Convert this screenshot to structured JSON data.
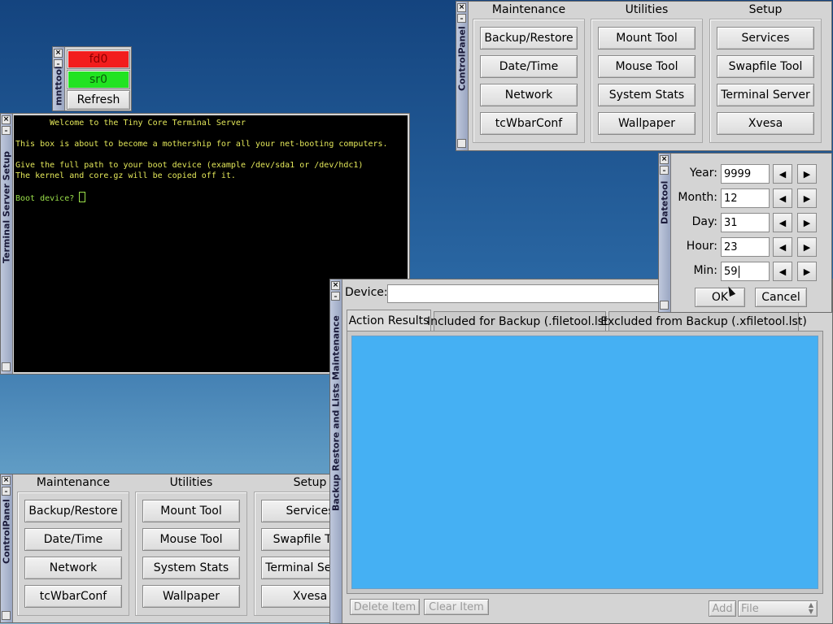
{
  "mnttool": {
    "title": "mnttool",
    "devices": [
      {
        "label": "fd0",
        "color": "#f21d1d"
      },
      {
        "label": "sr0",
        "color": "#22e322"
      }
    ],
    "refresh_label": "Refresh"
  },
  "control_panel": {
    "title": "ControlPanel",
    "groups": [
      {
        "heading": "Maintenance",
        "buttons": [
          "Backup/Restore",
          "Date/Time",
          "Network",
          "tcWbarConf"
        ]
      },
      {
        "heading": "Utilities",
        "buttons": [
          "Mount Tool",
          "Mouse Tool",
          "System Stats",
          "Wallpaper"
        ]
      },
      {
        "heading": "Setup",
        "buttons": [
          "Services",
          "Swapfile Tool",
          "Terminal Server",
          "Xvesa"
        ]
      }
    ]
  },
  "terminal_window": {
    "title": "Terminal Server Setup",
    "lines": [
      "       Welcome to the Tiny Core Terminal Server",
      "",
      "This box is about to become a mothership for all your net-booting computers.",
      "",
      "Give the full path to your boot device (example /dev/sda1 or /dev/hdc1)",
      "The kernel and core.gz will be copied off it.",
      "",
      "Boot device? "
    ]
  },
  "datetool": {
    "title": "Datetool",
    "fields": [
      {
        "label": "Year:",
        "value": "9999"
      },
      {
        "label": "Month:",
        "value": "12"
      },
      {
        "label": "Day:",
        "value": "31"
      },
      {
        "label": "Hour:",
        "value": "23"
      },
      {
        "label": "Min:",
        "value": "59"
      }
    ],
    "ok_label": "OK",
    "cancel_label": "Cancel"
  },
  "backup_window": {
    "title": "Backup Restore and Lists Maintenance",
    "device_label": "Device:",
    "device_value": "",
    "tabs": [
      "Action Results",
      "Included for Backup (.filetool.lst)",
      "Excluded from Backup (.xfiletool.lst)"
    ],
    "panel_color": "#45b0f3",
    "delete_label": "Delete Item",
    "clear_label": "Clear Item",
    "add_label": "Add",
    "file_select": "File"
  }
}
